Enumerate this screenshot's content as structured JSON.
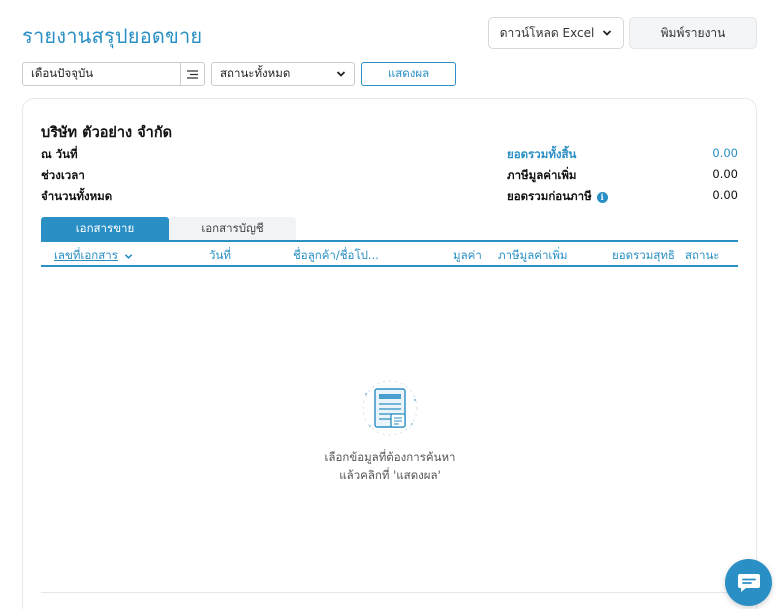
{
  "header": {
    "title": "รายงานสรุปยอดขาย",
    "export_label": "ดาวน์โหลด Excel",
    "print_label": "พิมพ์รายงาน"
  },
  "filters": {
    "period_value": "เดือนปัจจุบัน",
    "status_value": "สถานะทั้งหมด",
    "show_label": "แสดงผล"
  },
  "report": {
    "company": "บริษัท ตัวอย่าง จำกัด",
    "meta_labels": [
      "ณ วันที่",
      "ช่วงเวลา",
      "จำนวนทั้งหมด"
    ],
    "summary": [
      {
        "label": "ยอดรวมทั้งสิ้น",
        "value": "0.00"
      },
      {
        "label": "ภาษีมูลค่าเพิ่ม",
        "value": "0.00"
      },
      {
        "label": "ยอดรวมก่อนภาษี",
        "value": "0.00"
      }
    ]
  },
  "tabs": [
    "เอกสารขาย",
    "เอกสารบัญชี"
  ],
  "table": {
    "headers": [
      "เลขที่เอกสาร",
      "วันที่",
      "ชื่อลูกค้า/ชื่อโป...",
      "มูลค่า",
      "ภาษีมูลค่าเพิ่ม",
      "ยอดรวมสุทธิ",
      "สถานะ"
    ]
  },
  "empty_state": {
    "line1": "เลือกข้อมูลที่ต้องการค้นหา",
    "line2": "แล้วคลิกที่ 'แสดงผล'"
  },
  "colors": {
    "accent": "#2a8fc4",
    "border": "#c8ccd1"
  },
  "icons": [
    "chevron-down-icon",
    "list-menu-icon",
    "info-icon",
    "document-icon",
    "chat-icon"
  ]
}
